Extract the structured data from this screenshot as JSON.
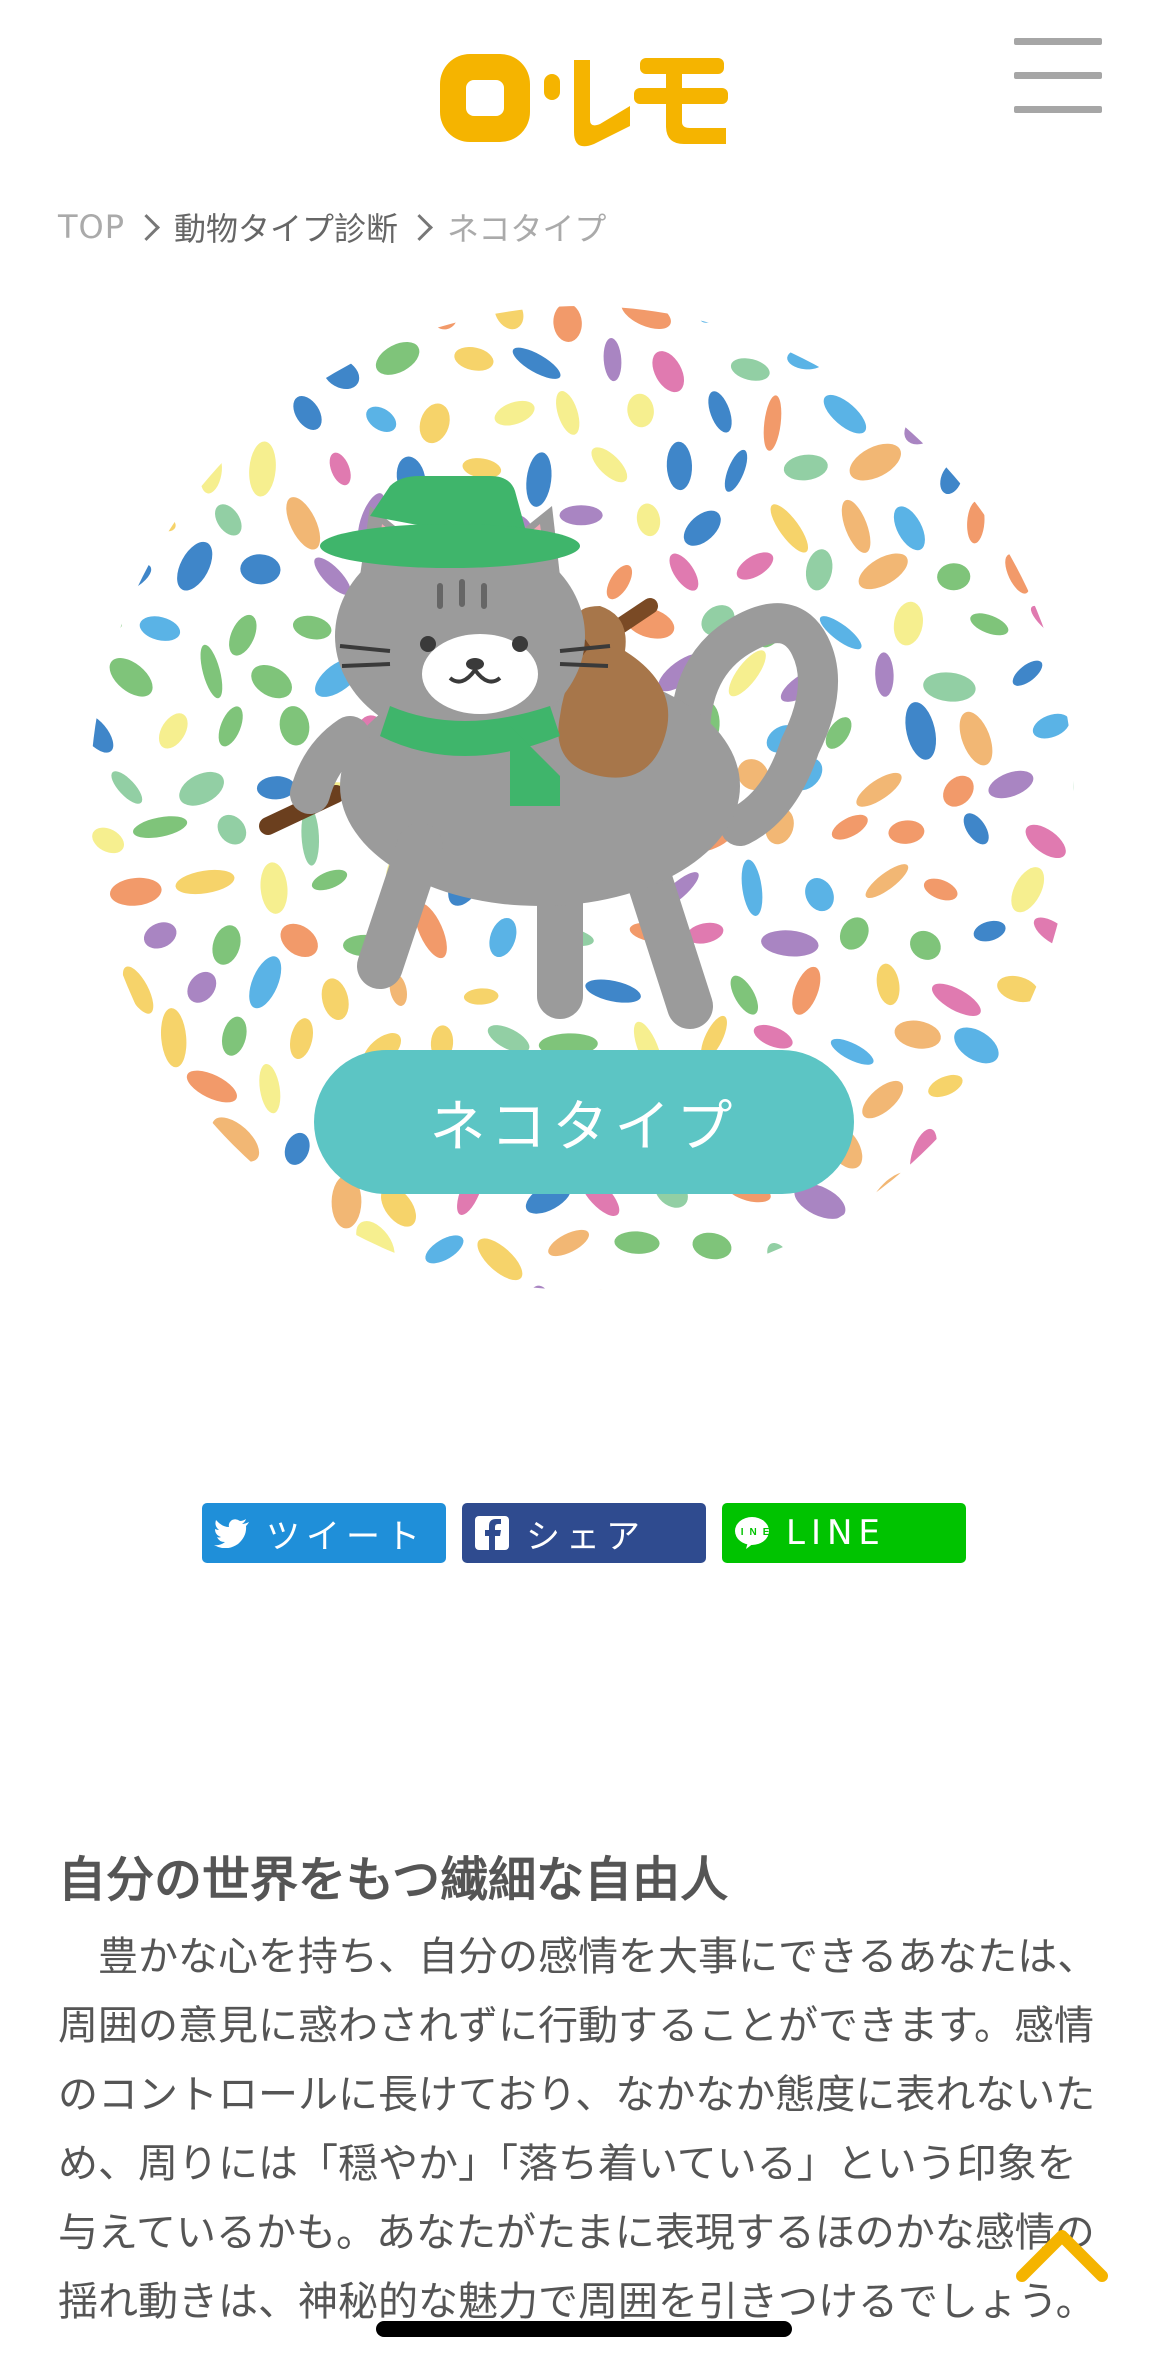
{
  "header": {
    "logo_text": "ロ・レモ"
  },
  "breadcrumb": {
    "items": [
      "TOP",
      "動物タイプ診断",
      "ネコタイプ"
    ]
  },
  "hero": {
    "type_label": "ネコタイプ"
  },
  "share": {
    "tweet": "ツイート",
    "share": "シェア",
    "line": "LINE"
  },
  "article": {
    "title": "自分の世界をもつ繊細な自由人",
    "body": "　豊かな心を持ち、自分の感情を大事にできるあなたは、周囲の意見に惑わされずに行動することができます。感情のコントロールに長けており、なかなか態度に表れないため、周りには「穏やか」「落ち着いている」という印象を与えているかも。あなたがたまに表現するほのかな感情の揺れ動きは、神秘的な魅力で周囲を引きつけるでしょう。"
  },
  "colors": {
    "logo": "#f5b400",
    "accent_teal": "#5cc5c4",
    "twitter": "#1f8fd9",
    "facebook": "#2f4b8f",
    "line": "#00c300",
    "page_top": "#f5b400"
  },
  "icons": [
    "menu-icon",
    "chevron-right-icon",
    "twitter-bird-icon",
    "facebook-icon",
    "line-icon",
    "chevron-up-icon"
  ]
}
